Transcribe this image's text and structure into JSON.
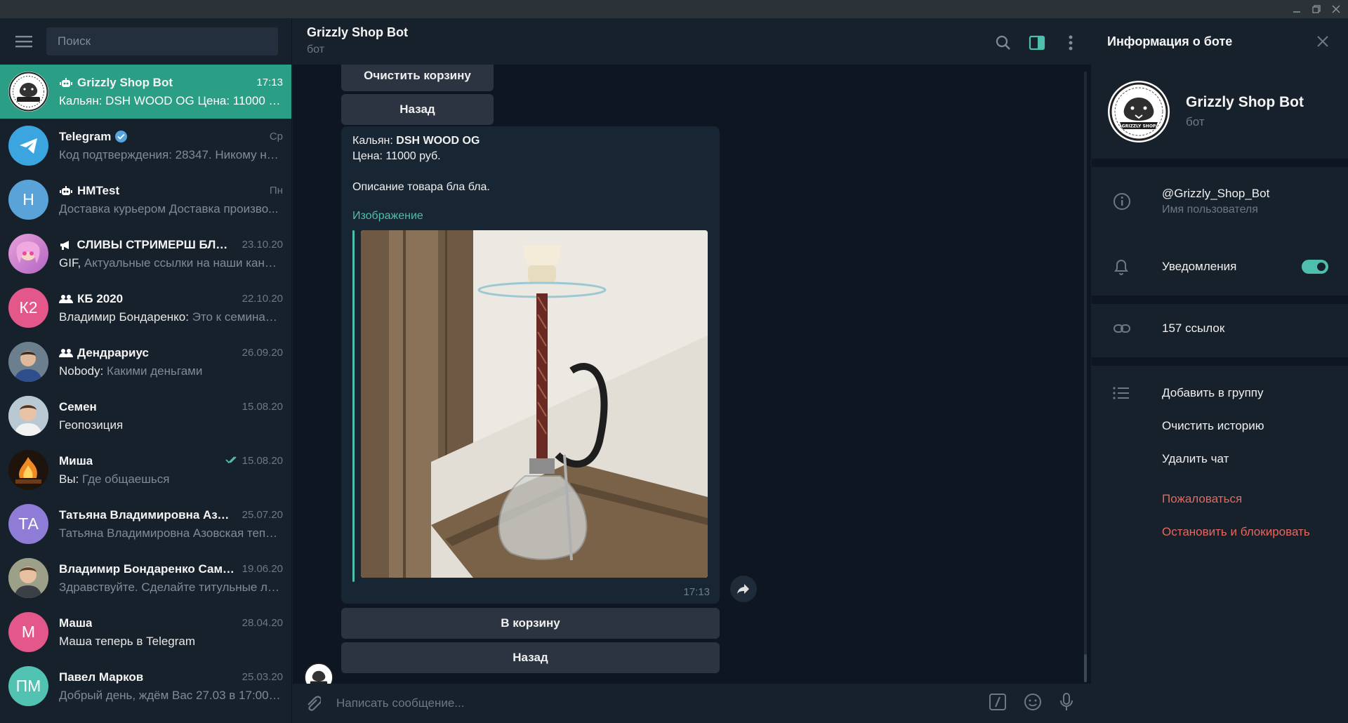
{
  "window": {
    "controls": [
      "minimize",
      "restore",
      "close"
    ]
  },
  "sidebar": {
    "search_placeholder": "Поиск",
    "chats": [
      {
        "name": "Grizzly Shop Bot",
        "time": "17:13",
        "preview": "Кальян: DSH WOOD OG Цена: 11000 ру...",
        "kind": "bot",
        "active": true
      },
      {
        "name": "Telegram",
        "time": "Ср",
        "preview": "Код подтверждения: 28347. Никому не ...",
        "kind": "verified"
      },
      {
        "name": "HMTest",
        "time": "Пн",
        "preview": "Доставка курьером  Доставка произво...",
        "kind": "bot",
        "initials": "H",
        "color": "#5aa3d9"
      },
      {
        "name": "СЛИВЫ СТРИМЕРШ БЛОГ...",
        "time": "23.10.20",
        "sender": "GIF,",
        "preview": " Актуальные ссылки на наши канал...",
        "kind": "channel"
      },
      {
        "name": "КБ 2020",
        "time": "22.10.20",
        "sender": "Владимир Бондаренко:",
        "preview": " Это к семинара...",
        "kind": "group",
        "initials": "К2",
        "color": "#e3578a"
      },
      {
        "name": "Дендрариус",
        "time": "26.09.20",
        "sender": "Nobody:",
        "preview": " Какими деньгами",
        "kind": "group"
      },
      {
        "name": "Семен",
        "time": "15.08.20",
        "preview": "Геопозиция",
        "sender": "",
        "kind": "user"
      },
      {
        "name": "Миша",
        "time": "15.08.20",
        "sender": "Вы:",
        "preview": " Где общаешься",
        "kind": "user",
        "read": true
      },
      {
        "name": "Татьяна Владимировна Азов...",
        "time": "25.07.20",
        "preview": "Татьяна Владимировна Азовская тепер...",
        "kind": "user",
        "initials": "ТА",
        "color": "#8e7cd6"
      },
      {
        "name": "Владимир Бондаренко Сама...",
        "time": "19.06.20",
        "preview": "Здравствуйте. Сделайте титульные лист...",
        "kind": "user"
      },
      {
        "name": "Маша",
        "time": "28.04.20",
        "preview": "Маша теперь в Telegram",
        "kind": "user",
        "initials": "М",
        "color": "#e3578a"
      },
      {
        "name": "Павел Марков",
        "time": "25.03.20",
        "preview": "Добрый день, ждём Вас 27.03 в 17:00 п...",
        "kind": "user",
        "initials": "ПМ",
        "color": "#52c2b3"
      }
    ]
  },
  "chat": {
    "title": "Grizzly Shop Bot",
    "subtitle": "бот",
    "kb_top": [
      "Очистить корзину",
      "Назад"
    ],
    "message": {
      "line1_prefix": "Кальян: ",
      "line1_bold": "DSH WOOD OG",
      "line2": "Цена: 11000 руб.",
      "line3": "Описание товара бла бла.",
      "link": "Изображение",
      "time": "17:13"
    },
    "kb_bottom": [
      "В корзину",
      "Назад"
    ],
    "composer_placeholder": "Написать сообщение..."
  },
  "info": {
    "title": "Информация о боте",
    "name": "Grizzly Shop Bot",
    "subtitle": "бот",
    "username": "@Grizzly_Shop_Bot",
    "username_label": "Имя пользователя",
    "notifications": "Уведомления",
    "notifications_on": true,
    "links": "157 ссылок",
    "actions": [
      "Добавить в группу",
      "Очистить историю",
      "Удалить чат"
    ],
    "danger_actions": [
      "Пожаловаться",
      "Остановить и блокировать"
    ],
    "logo_text": "GRIZZLY SHOP"
  },
  "colors": {
    "accent": "#4fbfad",
    "active_chat": "#2b9e86",
    "danger": "#e5675d",
    "bg": "#17212b",
    "chat_bg": "#0e1621"
  }
}
